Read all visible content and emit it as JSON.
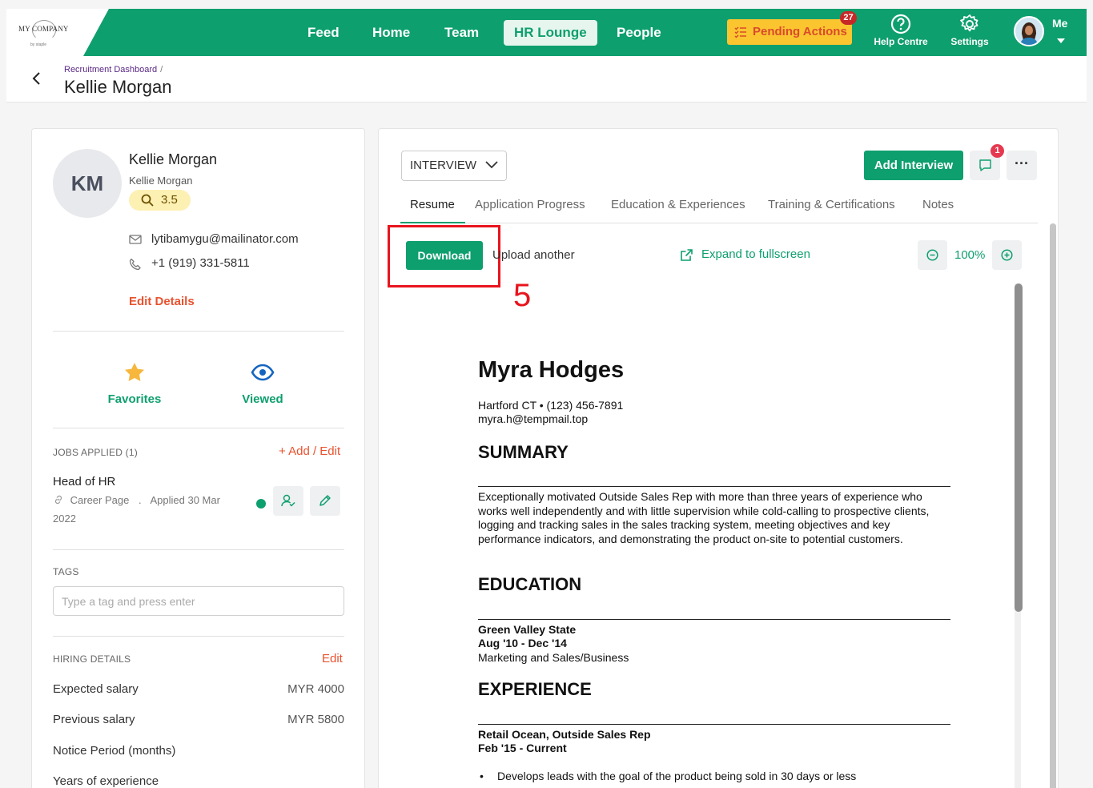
{
  "header": {
    "logo": {
      "name": "MY COMPANY",
      "tagline": "by staple"
    },
    "nav": [
      "Feed",
      "Home",
      "Team",
      "HR Lounge",
      "People"
    ],
    "active_nav": "HR Lounge",
    "pending_actions": {
      "label": "Pending Actions",
      "count": "27"
    },
    "help": "Help Centre",
    "settings": "Settings",
    "me": "Me"
  },
  "breadcrumb": {
    "parent": "Recruitment Dashboard",
    "separator": "/"
  },
  "page_title": "Kellie Morgan",
  "candidate": {
    "initials": "KM",
    "name": "Kellie Morgan",
    "subtitle": "Kellie Morgan",
    "rating": "3.5",
    "email": "lytibamygu@mailinator.com",
    "phone": "+1 (919) 331-5811",
    "edit_label": "Edit Details"
  },
  "stats": {
    "favorites": "Favorites",
    "viewed": "Viewed"
  },
  "jobs": {
    "label": "JOBS APPLIED (1)",
    "action": "+ Add / Edit",
    "title": "Head of HR",
    "source": "Career Page",
    "dot": ".",
    "applied_line1": "Applied 30 Mar",
    "applied_line2": "2022"
  },
  "tags": {
    "label": "TAGS",
    "placeholder": "Type a tag and press enter"
  },
  "hiring": {
    "label": "HIRING DETAILS",
    "action": "Edit",
    "rows": [
      {
        "label": "Expected salary",
        "value": "MYR 4000"
      },
      {
        "label": "Previous salary",
        "value": "MYR 5800"
      },
      {
        "label": "Notice Period (months)",
        "value": ""
      },
      {
        "label": "Years of experience",
        "value": ""
      }
    ]
  },
  "stage": "INTERVIEW",
  "actions": {
    "add_interview": "Add Interview",
    "comments_count": "1",
    "more": "···"
  },
  "tabs": [
    "Resume",
    "Application Progress",
    "Education & Experiences",
    "Training & Certifications",
    "Notes"
  ],
  "active_tab": "Resume",
  "toolbar": {
    "download": "Download",
    "upload": "Upload another",
    "expand": "Expand to fullscreen",
    "zoom": "100%"
  },
  "annotation": {
    "step": "5"
  },
  "resume": {
    "name": "Myra Hodges",
    "contact_line1": "Hartford CT • (123) 456-7891",
    "contact_line2": "myra.h@tempmail.top",
    "summary_heading": "SUMMARY",
    "summary": "Exceptionally motivated Outside Sales Rep with more than three years of experience who works well independently and with little supervision while cold-calling to prospective clients, logging and tracking sales in the sales tracking system, meeting objectives and key performance indicators, and demonstrating the product on-site to potential customers.",
    "education_heading": "EDUCATION",
    "school": "Green Valley State",
    "school_dates": "Aug '10 - Dec '14",
    "degree": "Marketing and Sales/Business",
    "experience_heading": "EXPERIENCE",
    "job": "Retail Ocean, Outside Sales Rep",
    "job_dates": "Feb '15 - Current",
    "bullet1": "Develops leads with the goal of the product being sold in 30 days or less"
  },
  "colors": {
    "brand": "#0e9f6e",
    "accent": "#e8522e",
    "pending": "#fbc530",
    "annotation": "#e8141d"
  }
}
